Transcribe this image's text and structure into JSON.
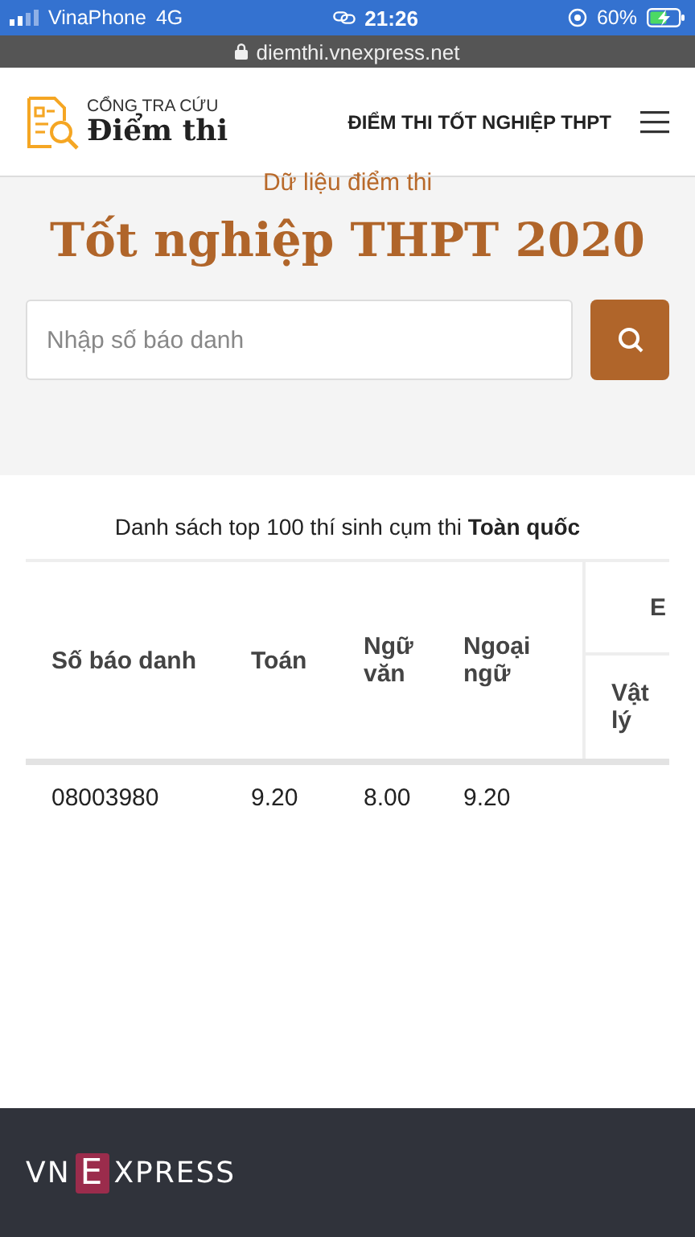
{
  "status_bar": {
    "carrier": "VinaPhone",
    "network": "4G",
    "time": "21:26",
    "battery": "60%",
    "charging": true
  },
  "address_bar": {
    "url": "diemthi.vnexpress.net"
  },
  "header": {
    "logo_top": "CỔNG TRA CỨU",
    "logo_bottom": "Điểm thi",
    "nav_title": "ĐIỂM THI TỐT NGHIỆP THPT"
  },
  "hero": {
    "subtitle": "Dữ liệu điểm thi",
    "title": "Tốt nghiệp THPT 2020",
    "search": {
      "placeholder": "Nhập số báo danh"
    }
  },
  "table": {
    "caption": "Danh sách top 100 thí sinh cụm thi **Toàn quốc**",
    "columns": [
      "Số báo danh",
      "Toán",
      "Ngữ văn",
      "Ngoại ngữ"
    ],
    "group_column": "E",
    "sub_columns": [
      "Vật lý"
    ],
    "rows": [
      {
        "cells": [
          "08003980",
          "9.20",
          "8.00",
          "9.20"
        ]
      }
    ]
  },
  "footer": {
    "logo_parts": [
      "VN",
      "E",
      "XPRESS"
    ]
  }
}
